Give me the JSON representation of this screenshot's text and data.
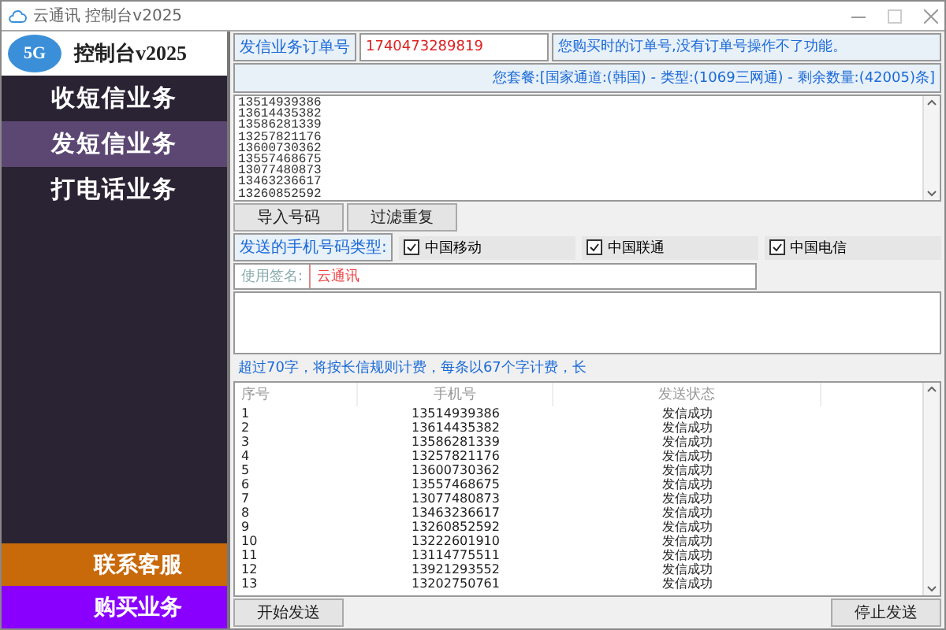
{
  "window": {
    "title": "云通讯 控制台v2025"
  },
  "sidebar": {
    "logo_badge": "5G",
    "logo_text": "控制台v2025",
    "items": [
      {
        "label": "收短信业务",
        "selected": false
      },
      {
        "label": "发短信业务",
        "selected": true
      },
      {
        "label": "打电话业务",
        "selected": false
      }
    ],
    "bottom_items": [
      {
        "label": "联系客服",
        "color": "#c8690a"
      },
      {
        "label": "购买业务",
        "color": "#8a00ff"
      }
    ]
  },
  "order": {
    "label": "发信业务订单号",
    "value": "1740473289819",
    "hint": "您购买时的订单号,没有订单号操作不了功能。"
  },
  "package": "您套餐:[国家通道:(韩国) - 类型:(1069三网通) - 剩余数量:(42005)条]",
  "numbers": [
    "13514939386",
    "13614435382",
    "13586281339",
    "13257821176",
    "13600730362",
    "13557468675",
    "13077480873",
    "13463236617",
    "13260852592"
  ],
  "number_buttons": [
    "导入号码",
    "过滤重复"
  ],
  "carrier_label": "发送的手机号码类型:",
  "carriers": [
    {
      "label": "中国移动",
      "checked": true
    },
    {
      "label": "中国联通",
      "checked": true
    },
    {
      "label": "中国电信",
      "checked": true
    }
  ],
  "signature": {
    "label": "使用签名:",
    "value": "云通讯"
  },
  "message_hint": "超过70字，将按长信规则计费，每条以67个字计费，长",
  "table": {
    "columns": [
      "序号",
      "手机号",
      "发送状态"
    ],
    "rows": [
      [
        "1",
        "13514939386",
        "发信成功"
      ],
      [
        "2",
        "13614435382",
        "发信成功"
      ],
      [
        "3",
        "13586281339",
        "发信成功"
      ],
      [
        "4",
        "13257821176",
        "发信成功"
      ],
      [
        "5",
        "13600730362",
        "发信成功"
      ],
      [
        "6",
        "13557468675",
        "发信成功"
      ],
      [
        "7",
        "13077480873",
        "发信成功"
      ],
      [
        "8",
        "13463236617",
        "发信成功"
      ],
      [
        "9",
        "13260852592",
        "发信成功"
      ],
      [
        "10",
        "13222601910",
        "发信成功"
      ],
      [
        "11",
        "13114775511",
        "发信成功"
      ],
      [
        "12",
        "13921293552",
        "发信成功"
      ],
      [
        "13",
        "13202750761",
        "发信成功"
      ]
    ]
  },
  "actions": {
    "start": "开始发送",
    "stop": "停止发送"
  }
}
